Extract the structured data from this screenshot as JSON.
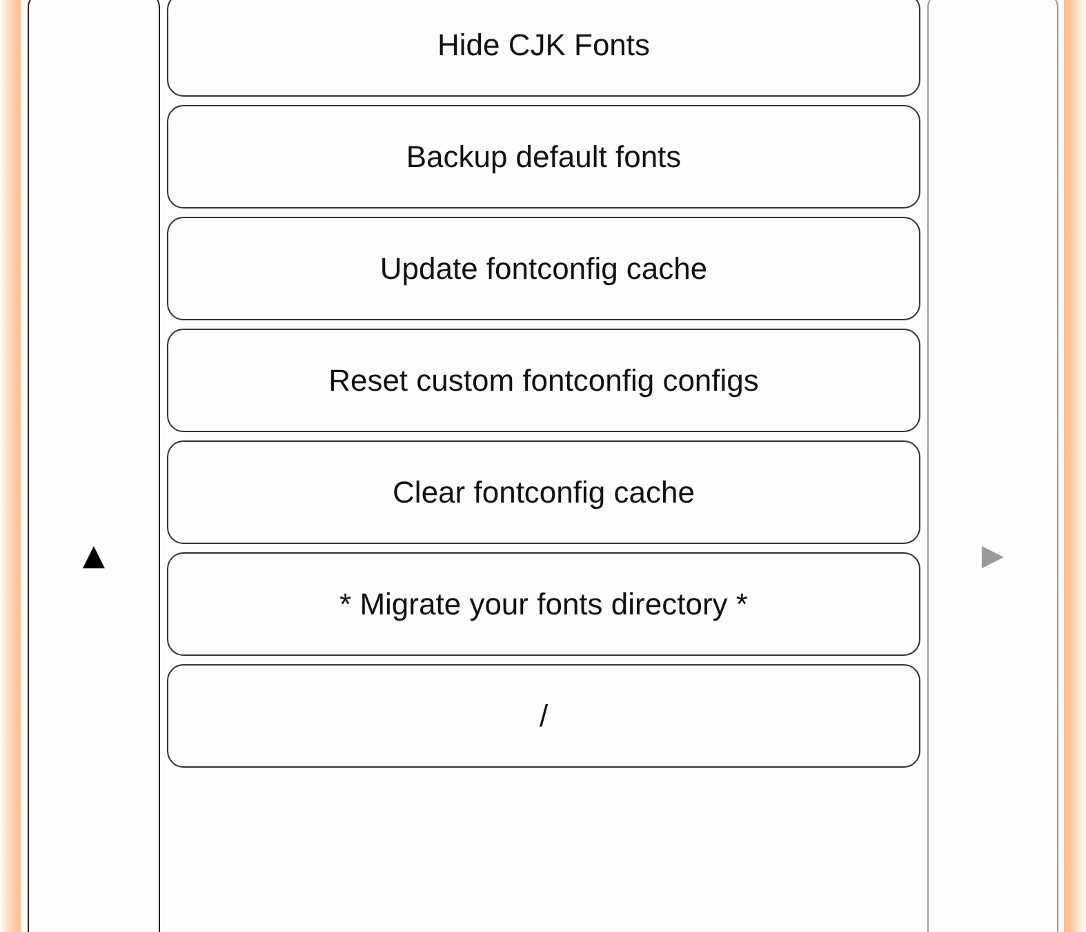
{
  "scroll_up": {
    "label": "▲",
    "disabled": false
  },
  "actions": [
    {
      "label": "Hide CJK Fonts"
    },
    {
      "label": "Backup default fonts"
    },
    {
      "label": "Update fontconfig cache"
    },
    {
      "label": "Reset custom fontconfig configs"
    },
    {
      "label": "Clear fontconfig cache"
    },
    {
      "label": "* Migrate your fonts directory *"
    },
    {
      "label": "/"
    }
  ],
  "next_page": {
    "label": "▶",
    "disabled": true
  }
}
